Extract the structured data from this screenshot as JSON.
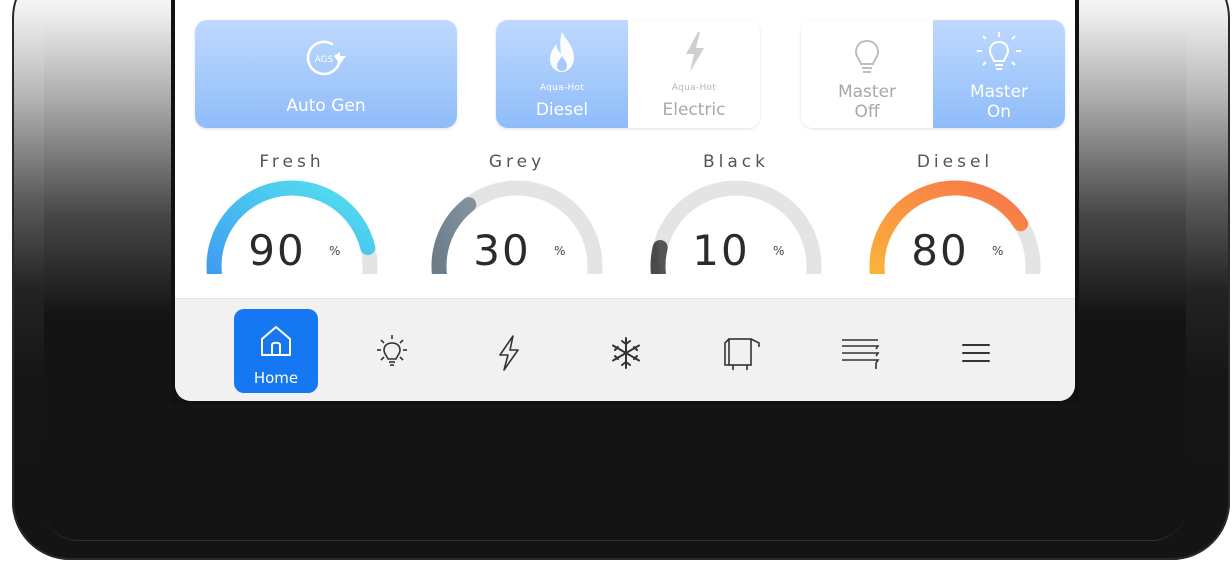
{
  "controls": {
    "auto_gen": {
      "badge": "AGS",
      "label": "Auto Gen"
    },
    "aqua_hot": {
      "diesel": {
        "small": "Aqua-Hot",
        "label": "Diesel"
      },
      "electric": {
        "small": "Aqua-Hot",
        "label": "Electric"
      }
    },
    "master": {
      "off": {
        "line1": "Master",
        "line2": "Off"
      },
      "on": {
        "line1": "Master",
        "line2": "On"
      }
    }
  },
  "gauges": [
    {
      "title": "Fresh",
      "value": "90",
      "unit": "%",
      "level": 0.9,
      "color_start": "#3f9cf2",
      "color_end": "#53e3ee"
    },
    {
      "title": "Grey",
      "value": "30",
      "unit": "%",
      "level": 0.3,
      "color_start": "#6b7c88",
      "color_end": "#7f929e"
    },
    {
      "title": "Black",
      "value": "10",
      "unit": "%",
      "level": 0.1,
      "color_start": "#4a4a4a",
      "color_end": "#555555"
    },
    {
      "title": "Diesel",
      "value": "80",
      "unit": "%",
      "level": 0.8,
      "color_start": "#fbb23a",
      "color_end": "#f7754a"
    }
  ],
  "nav": {
    "items": [
      {
        "icon": "home-icon",
        "label": "Home",
        "active": true
      },
      {
        "icon": "lightbulb-icon",
        "label": "",
        "active": false
      },
      {
        "icon": "lightning-icon",
        "label": "",
        "active": false
      },
      {
        "icon": "snowflake-icon",
        "label": "",
        "active": false
      },
      {
        "icon": "slide-out-icon",
        "label": "",
        "active": false
      },
      {
        "icon": "awning-icon",
        "label": "",
        "active": false
      },
      {
        "icon": "menu-icon",
        "label": "",
        "active": false
      }
    ]
  },
  "colors": {
    "accent": "#1677f2",
    "track": "#e4e4e4",
    "button_blue_top": "#bfd9ff",
    "button_blue_bottom": "#8fbcf9"
  }
}
